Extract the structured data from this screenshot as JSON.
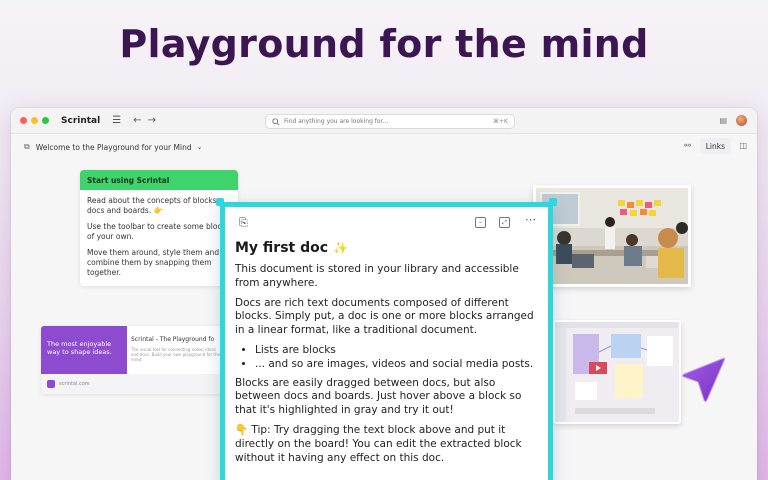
{
  "headline": "Playground for the mind",
  "window": {
    "app_title": "Scrintal",
    "search_placeholder": "Find anything you are looking for...",
    "search_shortcut": "⌘+K",
    "board_title": "Welcome to the Playground for your Mind",
    "links_label": "Links"
  },
  "start_card": {
    "title": "Start using Scrintal",
    "items": [
      "Read about the concepts of blocks, docs and boards. 👉",
      "Use the toolbar to create some blocks of your own.",
      "Move them around, style them and combine them by snapping them together."
    ]
  },
  "link_card": {
    "thumb_text": "The most enjoyable way to shape ideas.",
    "title": "Scrintal - The Playground fo",
    "description": "The visual tool for connecting notes, ideas and docs. Build your own playground for the mind.",
    "domain": "scrintal.com"
  },
  "doc": {
    "title": "My first doc",
    "title_emoji": "✨",
    "p1": "This document is stored in your library and accessible from anywhere.",
    "p2": "Docs are rich text documents composed of different blocks. Simply put, a doc is one or more blocks arranged in a linear format, like a traditional document.",
    "bullets": [
      "Lists are blocks",
      "... and so are images, videos and social media posts."
    ],
    "p3": "Blocks are easily dragged between docs, but also between docs and boards. Just hover above a block so that it's highlighted in gray and try it out!",
    "tip": "👇 Tip: Try dragging the text block above and put it directly on the board! You can edit the extracted block without it having any effect on this doc."
  },
  "colors": {
    "accent_green": "#3ed36b",
    "doc_border": "#2fd6dc",
    "headline": "#3b1651",
    "cursor": "#8a3fd1"
  }
}
